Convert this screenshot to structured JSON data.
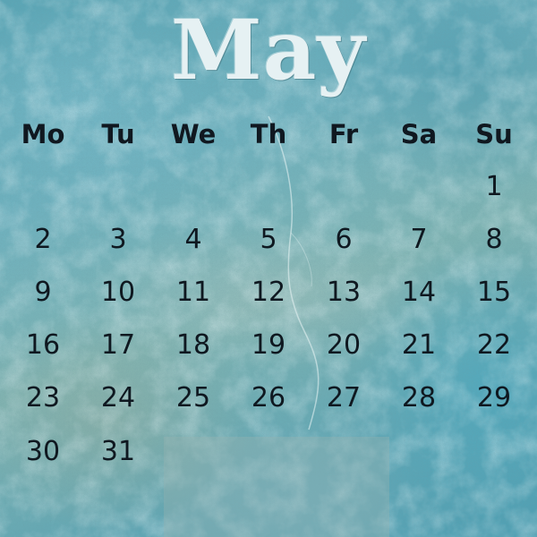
{
  "month": "May",
  "weekdays": [
    "Mo",
    "Tu",
    "We",
    "Th",
    "Fr",
    "Sa",
    "Su"
  ],
  "first_weekday_index": 6,
  "days": [
    "1",
    "2",
    "3",
    "4",
    "5",
    "6",
    "7",
    "8",
    "9",
    "10",
    "11",
    "12",
    "13",
    "14",
    "15",
    "16",
    "17",
    "18",
    "19",
    "20",
    "21",
    "22",
    "23",
    "24",
    "25",
    "26",
    "27",
    "28",
    "29",
    "30",
    "31"
  ]
}
